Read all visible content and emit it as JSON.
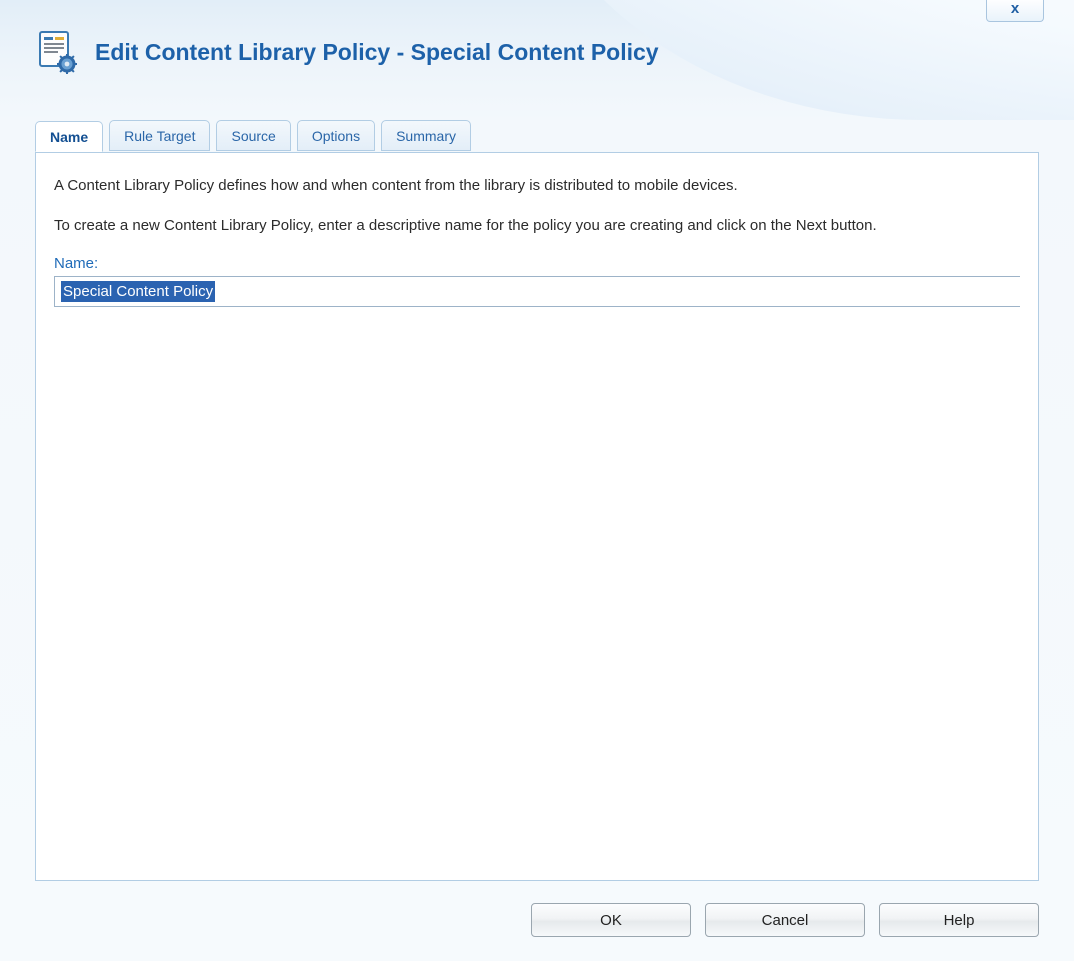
{
  "window": {
    "close_glyph": "x"
  },
  "header": {
    "title": "Edit Content Library Policy - Special Content Policy"
  },
  "tabs": [
    {
      "id": "name",
      "label": "Name",
      "active": true
    },
    {
      "id": "rule-target",
      "label": "Rule Target",
      "active": false
    },
    {
      "id": "source",
      "label": "Source",
      "active": false
    },
    {
      "id": "options",
      "label": "Options",
      "active": false
    },
    {
      "id": "summary",
      "label": "Summary",
      "active": false
    }
  ],
  "panel": {
    "intro1": "A Content Library Policy defines how and when content from the library is distributed to mobile devices.",
    "intro2": "To create a new Content Library Policy, enter a descriptive name for the policy you are creating and click on the Next button.",
    "name_field": {
      "label": "Name:",
      "value": "Special Content Policy",
      "selected": true
    }
  },
  "footer": {
    "ok_label": "OK",
    "cancel_label": "Cancel",
    "help_label": "Help"
  },
  "colors": {
    "accent": "#1d61a9",
    "link": "#2a66a8",
    "panel_border": "#b2cde4",
    "selection_bg": "#2b63b1"
  }
}
